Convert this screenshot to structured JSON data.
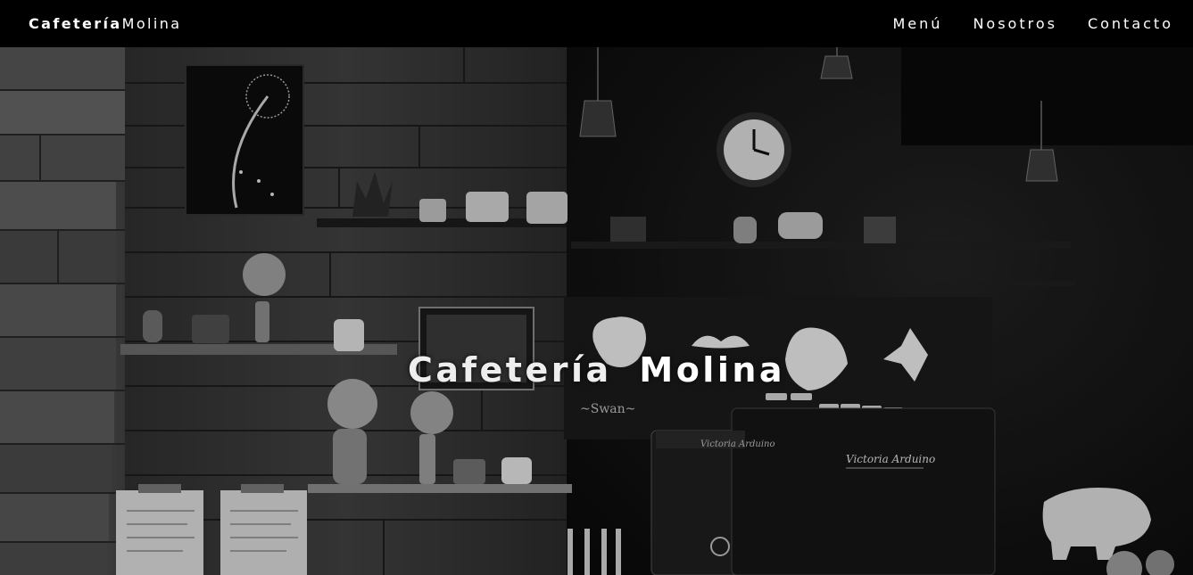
{
  "navbar": {
    "brand_bold": "Cafetería",
    "brand_regular": "Molina",
    "links": [
      "Menú",
      "Nosotros",
      "Contacto"
    ]
  },
  "hero": {
    "title_bold": "Cafetería",
    "title_regular": "Molina",
    "background": "Black and white photo of a coffee shop interior with wooden plank wall, shelves with plants and baskets, wall clock, latte art decals and an espresso machine"
  },
  "colors": {
    "navbar_bg": "#000000",
    "text": "#ffffff"
  }
}
